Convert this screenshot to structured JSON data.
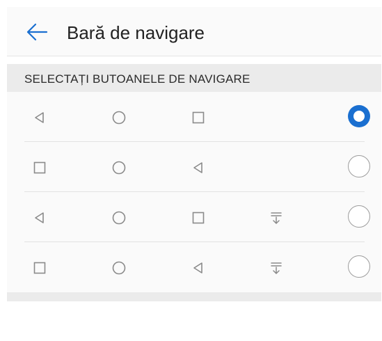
{
  "header": {
    "title": "Bară de navigare",
    "back_icon": "arrow-left-icon"
  },
  "section": {
    "title": "SELECTAȚI BUTOANELE DE NAVIGARE"
  },
  "colors": {
    "accent": "#1a6fd0",
    "icon_gray": "#8a8a8a",
    "section_bg": "#ebebeb"
  },
  "options": [
    {
      "buttons": [
        "back-icon",
        "home-icon",
        "recents-icon"
      ],
      "selected": true
    },
    {
      "buttons": [
        "recents-icon",
        "home-icon",
        "back-icon"
      ],
      "selected": false
    },
    {
      "buttons": [
        "back-icon",
        "home-icon",
        "recents-icon",
        "notification-icon"
      ],
      "selected": false
    },
    {
      "buttons": [
        "recents-icon",
        "home-icon",
        "back-icon",
        "notification-icon"
      ],
      "selected": false
    }
  ]
}
